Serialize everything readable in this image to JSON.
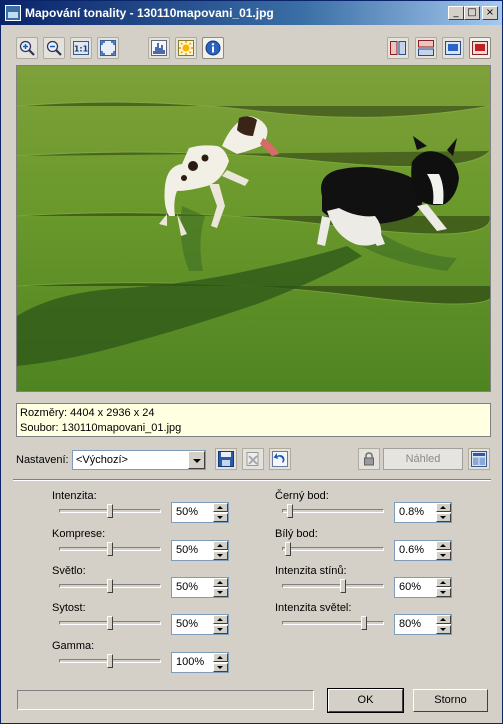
{
  "window": {
    "title": "Mapování tonality - 130110mapovani_01.jpg"
  },
  "titlebar_buttons": {
    "minimize": "_",
    "maximize": "□",
    "close": "×"
  },
  "toolbar": {
    "left_icons": [
      "zoom-in-icon",
      "zoom-out-icon",
      "actual-size-icon",
      "fit-window-icon"
    ],
    "mid_icons": [
      "histogram-icon",
      "highlight-icon",
      "info-icon"
    ],
    "actual_size_label": "1:1",
    "right_icons": [
      "split-vertical-icon",
      "split-horizontal-icon",
      "single-view-icon",
      "original-view-icon"
    ]
  },
  "info": {
    "dimensions": "Rozměry: 4404 x 2936 x 24",
    "file": "Soubor: 130110mapovani_01.jpg"
  },
  "settings": {
    "label": "Nastavení:",
    "preset": "<Výchozí>",
    "preview_label": "Náhled"
  },
  "left_params": [
    {
      "label": "Intenzita:",
      "value": "50%",
      "level": 0.5
    },
    {
      "label": "Komprese:",
      "value": "50%",
      "level": 0.5
    },
    {
      "label": "Světlo:",
      "value": "50%",
      "level": 0.5
    },
    {
      "label": "Sytost:",
      "value": "50%",
      "level": 0.5
    },
    {
      "label": "Gamma:",
      "value": "100%",
      "level": 0.5
    }
  ],
  "right_params": [
    {
      "label": "Černý bod:",
      "value": "0.8%",
      "level": 0.08
    },
    {
      "label": "Bílý bod:",
      "value": "0.6%",
      "level": 0.06
    },
    {
      "label": "Intenzita stínů:",
      "value": "60%",
      "level": 0.6
    },
    {
      "label": "Intenzita světel:",
      "value": "80%",
      "level": 0.8
    }
  ],
  "footer": {
    "ok_label": "OK",
    "cancel_label": "Storno",
    "progress": 0
  }
}
